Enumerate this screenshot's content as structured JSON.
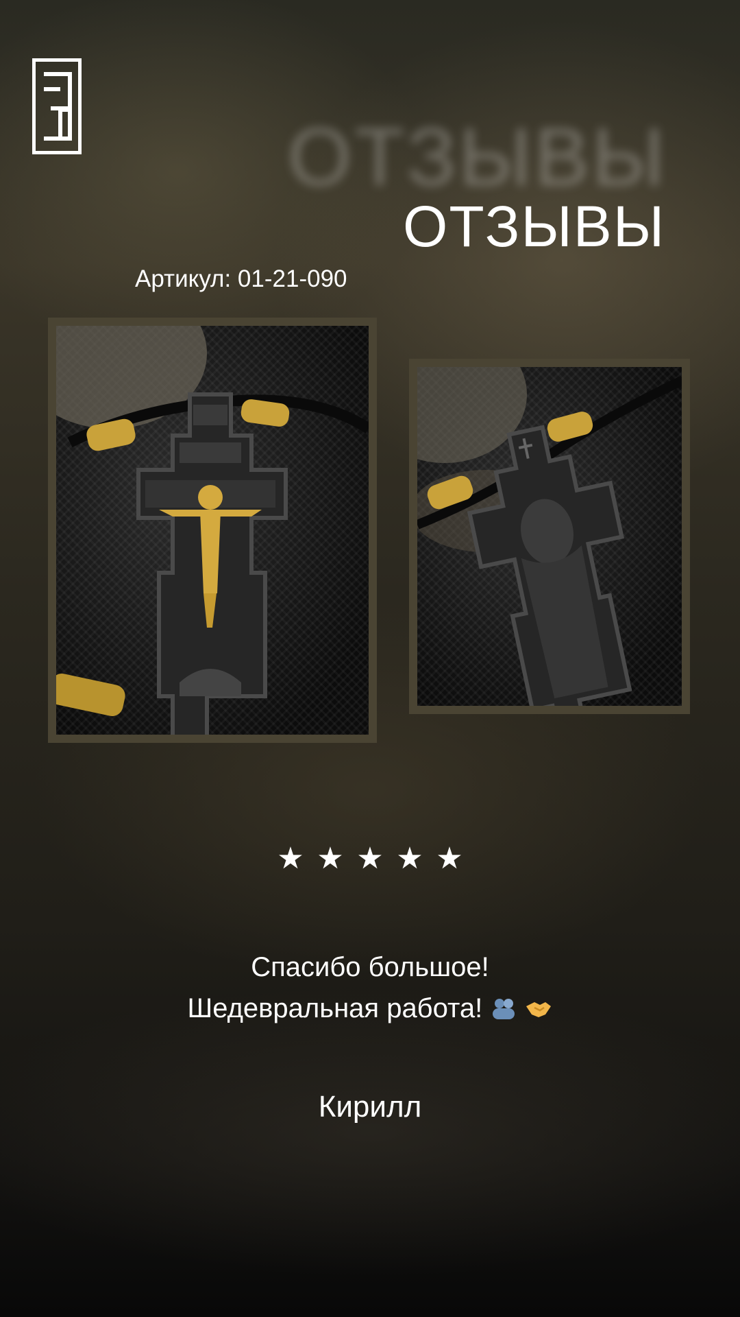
{
  "brand": {
    "logo_icon": "brand-logo-z-icon"
  },
  "header": {
    "ghost_title": "ОТЗЫВЫ",
    "title": "ОТЗЫВЫ",
    "article": "Артикул: 01-21-090"
  },
  "photos": [
    {
      "icon": "wooden-crucifix-front-photo"
    },
    {
      "icon": "wooden-cross-back-virgin-photo"
    }
  ],
  "rating": {
    "stars": 5,
    "max": 5
  },
  "review": {
    "line1": "Спасибо большое!",
    "line2": "Шедевральная работа!",
    "emojis": [
      "people-icon",
      "handshake-icon"
    ],
    "author": "Кирилл"
  },
  "colors": {
    "frame": "#4a4433",
    "text": "#ffffff",
    "gold": "#c9a23a"
  }
}
